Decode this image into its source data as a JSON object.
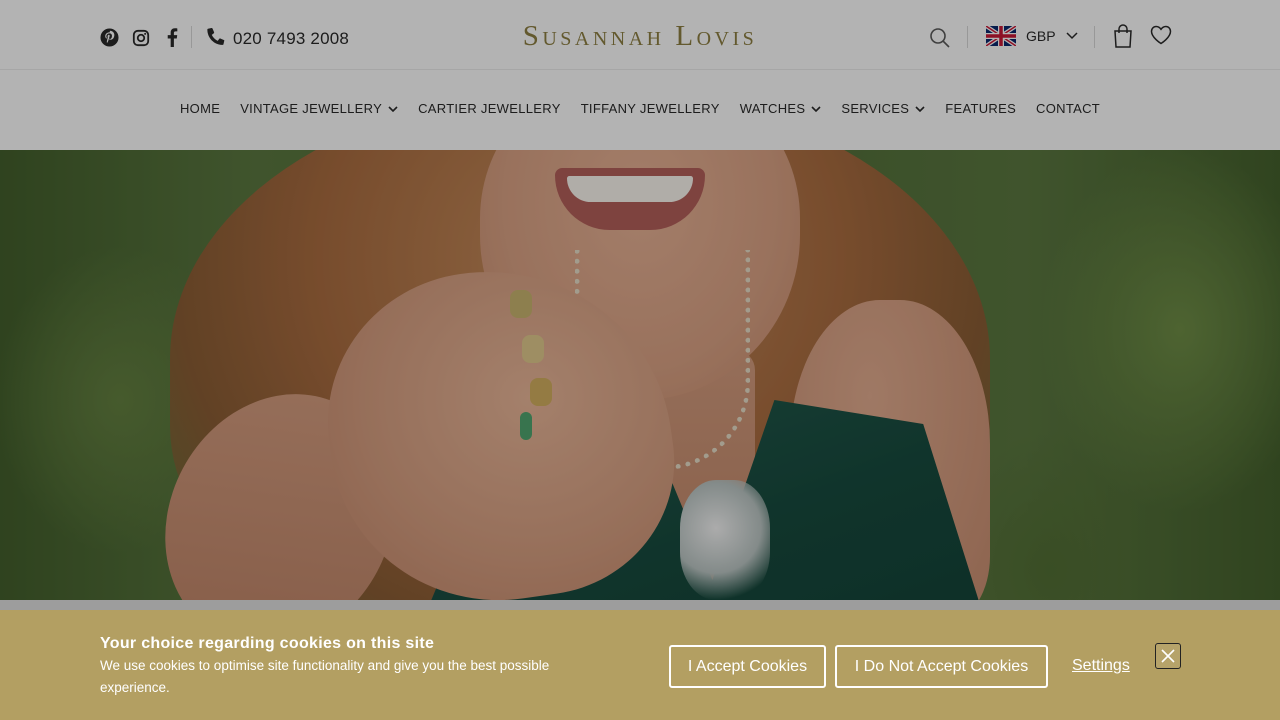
{
  "header": {
    "social_icons": [
      "pinterest-icon",
      "instagram-icon",
      "facebook-icon"
    ],
    "phone_number": "020 7493 2008",
    "logo_text": "Susannah Lovis",
    "currency": {
      "code": "GBP",
      "flag": "uk-flag-icon"
    },
    "icons": [
      "search-icon",
      "shopping-bag-icon",
      "heart-icon"
    ]
  },
  "nav": {
    "items": [
      {
        "label": "HOME",
        "has_dropdown": false
      },
      {
        "label": "VINTAGE JEWELLERY",
        "has_dropdown": true
      },
      {
        "label": "CARTIER JEWELLERY",
        "has_dropdown": false
      },
      {
        "label": "TIFFANY JEWELLERY",
        "has_dropdown": false
      },
      {
        "label": "WATCHES",
        "has_dropdown": true
      },
      {
        "label": "SERVICES",
        "has_dropdown": true
      },
      {
        "label": "FEATURES",
        "has_dropdown": false
      },
      {
        "label": "CONTACT",
        "has_dropdown": false
      }
    ]
  },
  "cookie_banner": {
    "title": "Your choice regarding cookies on this site",
    "text": "We use cookies to optimise site functionality and give you the best possible experience.",
    "accept_label": "I Accept Cookies",
    "decline_label": "I Do Not Accept Cookies",
    "settings_label": "Settings"
  },
  "colors": {
    "brand_gold": "#8a7b3b",
    "cookie_background": "#b39f62",
    "text_dark": "#222222"
  }
}
